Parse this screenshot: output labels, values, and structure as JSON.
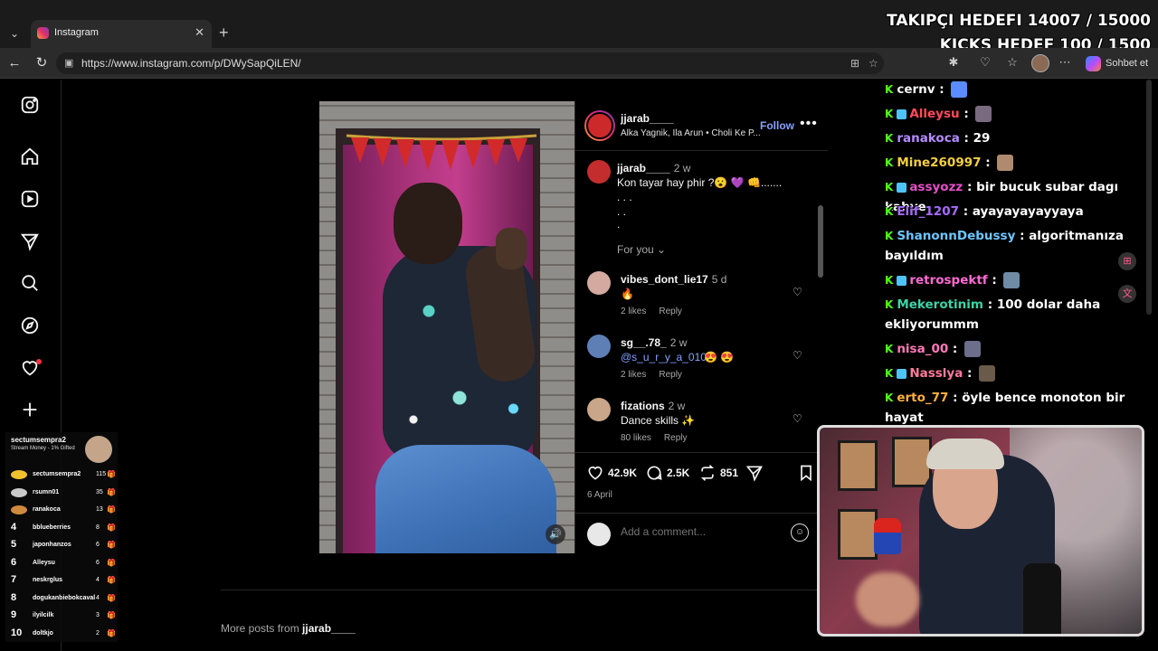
{
  "browser": {
    "tab_title": "Instagram",
    "url": "https://www.instagram.com/p/DWySapQiLEN/",
    "copilot_label": "Sohbet et"
  },
  "overlay": {
    "follower_goal": "TAKIPÇI HEDEFI 14007 / 15000",
    "kicks_goal": "KICKS HEDEF 100 / 1500"
  },
  "post": {
    "username": "jjarab____",
    "audio": "Alka Yagnik, Ila Arun • Choli Ke P...",
    "follow_label": "Follow",
    "caption_user": "jjarab____",
    "caption_time": "2 w",
    "caption_text": "Kon tayar hay phir ?😮 💜 👊.......",
    "caption_dots": [
      ". . .",
      ". .",
      "."
    ],
    "for_you_label": "For you",
    "comments": [
      {
        "user": "vibes_dont_lie17",
        "time": "5 d",
        "text": "🔥",
        "likes": "2 likes",
        "reply": "Reply"
      },
      {
        "user": "sg__.78_",
        "time": "2 w",
        "mention": "@s_u_r_y_a_0101",
        "text": "😍 😍",
        "likes": "2 likes",
        "reply": "Reply"
      },
      {
        "user": "fizations",
        "time": "2 w",
        "text": "Dance skills ✨",
        "likes": "80 likes",
        "reply": "Reply"
      }
    ],
    "likes_count": "42.9K",
    "comments_count": "2.5K",
    "reposts_count": "851",
    "date": "6 April",
    "add_comment_placeholder": "Add a comment...",
    "more_posts_prefix": "More posts from",
    "more_posts_user": "jjarab____"
  },
  "leaderboard": {
    "title": "sectumsempra2",
    "subtitle": "Stream Money - 1% Gifted",
    "rows": [
      {
        "rank": "",
        "name": "sectumsempra2",
        "count": "115",
        "medal": "#f2c12e"
      },
      {
        "rank": "",
        "name": "rsumn01",
        "count": "35",
        "medal": "#c9c9c9"
      },
      {
        "rank": "",
        "name": "ranakoca",
        "count": "13",
        "medal": "#d08a3c"
      },
      {
        "rank": "4",
        "name": "bblueberries",
        "count": "8"
      },
      {
        "rank": "5",
        "name": "japonhanzos",
        "count": "6"
      },
      {
        "rank": "6",
        "name": "Alleysu",
        "count": "6"
      },
      {
        "rank": "7",
        "name": "neskrglus",
        "count": "4"
      },
      {
        "rank": "8",
        "name": "dogukanbiebokcaval",
        "count": "4"
      },
      {
        "rank": "9",
        "name": "ilyilcilk",
        "count": "3"
      },
      {
        "rank": "10",
        "name": "doltkjo",
        "count": "2"
      }
    ]
  },
  "chat": [
    {
      "user": "cernv",
      "color": "#f5f5f5",
      "text": "",
      "emote": "#5b8cff"
    },
    {
      "user": "Alleysu",
      "color": "#ff4b5c",
      "text": "",
      "emote": "#7a6a80"
    },
    {
      "user": "ranakoca",
      "color": "#b58cff",
      "text": "29"
    },
    {
      "user": "Mine260997",
      "color": "#f4d03f",
      "text": "",
      "emote": "#b08a70"
    },
    {
      "user": "assyozz",
      "color": "#e64ec9",
      "text": "bir bucuk subar dagı kahve"
    },
    {
      "user": "Elif_1207",
      "color": "#a86bff",
      "text": "ayayayayayyaya"
    },
    {
      "user": "ShanonnDebussy",
      "color": "#6ec6ff",
      "text": "algoritmanıza bayıldım"
    },
    {
      "user": "retrospektf",
      "color": "#ff6ad5",
      "text": "",
      "emote": "#6f8aa5"
    },
    {
      "user": "Mekerotinim",
      "color": "#3cd3a6",
      "text": "100 dolar daha ekliyorummm"
    },
    {
      "user": "nisa_00",
      "color": "#ff7ab8",
      "text": "",
      "emote": "#6d6d8c"
    },
    {
      "user": "Nasslya",
      "color": "#ff7a9c",
      "text": "",
      "emote": "#6a5a4a"
    },
    {
      "user": "erto_77",
      "color": "#ffb13c",
      "text": "öyle bence monoton bir hayat"
    }
  ],
  "colors": {
    "ig_link": "#85a1ff",
    "kick_green": "#53fc18",
    "notif_red": "#ff3040"
  }
}
